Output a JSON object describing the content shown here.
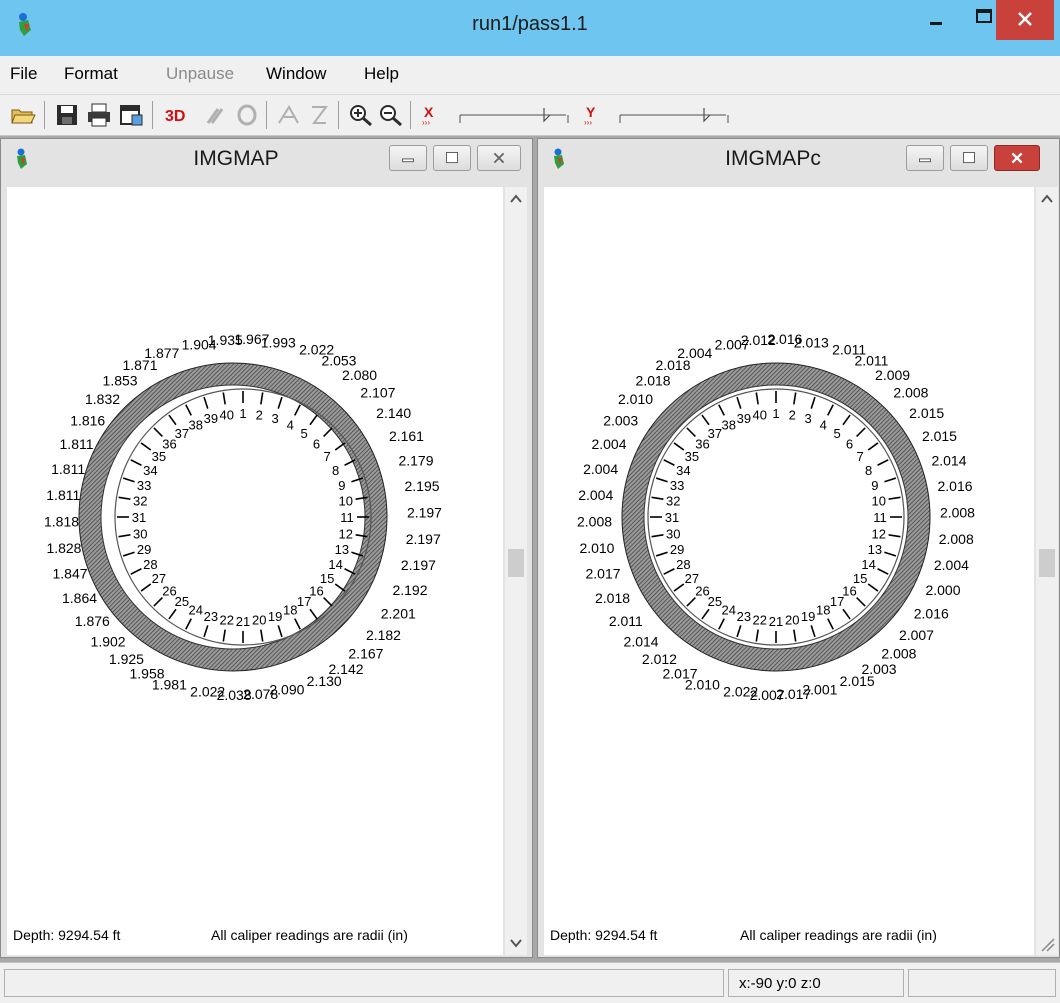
{
  "window": {
    "title": "run1/pass1.1"
  },
  "menu": [
    {
      "label": "File",
      "enabled": true
    },
    {
      "label": "Format",
      "enabled": true
    },
    {
      "label": "Unpause",
      "enabled": false
    },
    {
      "label": "Window",
      "enabled": true
    },
    {
      "label": "Help",
      "enabled": true
    }
  ],
  "toolbar": {
    "buttons": [
      "open-icon",
      "save-icon",
      "print-icon",
      "export-icon",
      "3d-icon",
      "tool-disabled-icon",
      "tool-disabled-icon",
      "tool-disabled-icon",
      "tool-disabled-icon",
      "zoom-in-icon",
      "zoom-out-icon",
      "x-scale-icon",
      "y-scale-icon"
    ],
    "label_3d": "3D",
    "x_scale_label": "X",
    "y_scale_label": "Y"
  },
  "panes": [
    {
      "title": "IMGMAP",
      "depth": "Depth: 9294.54 ft",
      "note": "All caliper readings are radii (in)",
      "readings": [
        "1.967",
        "1.993",
        "2.022",
        "2.053",
        "2.080",
        "2.107",
        "2.140",
        "2.161",
        "2.179",
        "2.195",
        "2.197",
        "2.197",
        "2.197",
        "2.192",
        "2.201",
        "2.182",
        "2.167",
        "2.142",
        "2.130",
        "2.090",
        "2.078",
        "2.038",
        "2.022",
        "1.981",
        "1.958",
        "1.925",
        "1.902",
        "1.876",
        "1.864",
        "1.847",
        "1.828",
        "1.818",
        "1.811",
        "1.811",
        "1.811",
        "1.816",
        "1.832",
        "1.853",
        "1.871",
        "1.877",
        "1.904",
        "1.935"
      ]
    },
    {
      "title": "IMGMAPc",
      "depth": "Depth: 9294.54 ft",
      "note": "All caliper readings are radii (in)",
      "readings": [
        "2.016",
        "2.013",
        "2.011",
        "2.011",
        "2.009",
        "2.008",
        "2.015",
        "2.015",
        "2.014",
        "2.016",
        "2.008",
        "2.008",
        "2.004",
        "2.000",
        "2.016",
        "2.007",
        "2.008",
        "2.003",
        "2.015",
        "2.001",
        "2.017",
        "2.007",
        "2.022",
        "2.010",
        "2.017",
        "2.012",
        "2.014",
        "2.011",
        "2.018",
        "2.017",
        "2.010",
        "2.008",
        "2.004",
        "2.004",
        "2.004",
        "2.003",
        "2.010",
        "2.018",
        "2.018",
        "2.004",
        "2.007",
        "2.012"
      ]
    }
  ],
  "status": {
    "coords": "x:-90 y:0 z:0"
  },
  "colors": {
    "titlebar": "#6ec6f0",
    "close": "#c8413a",
    "mdi": "#a9a9a9"
  }
}
